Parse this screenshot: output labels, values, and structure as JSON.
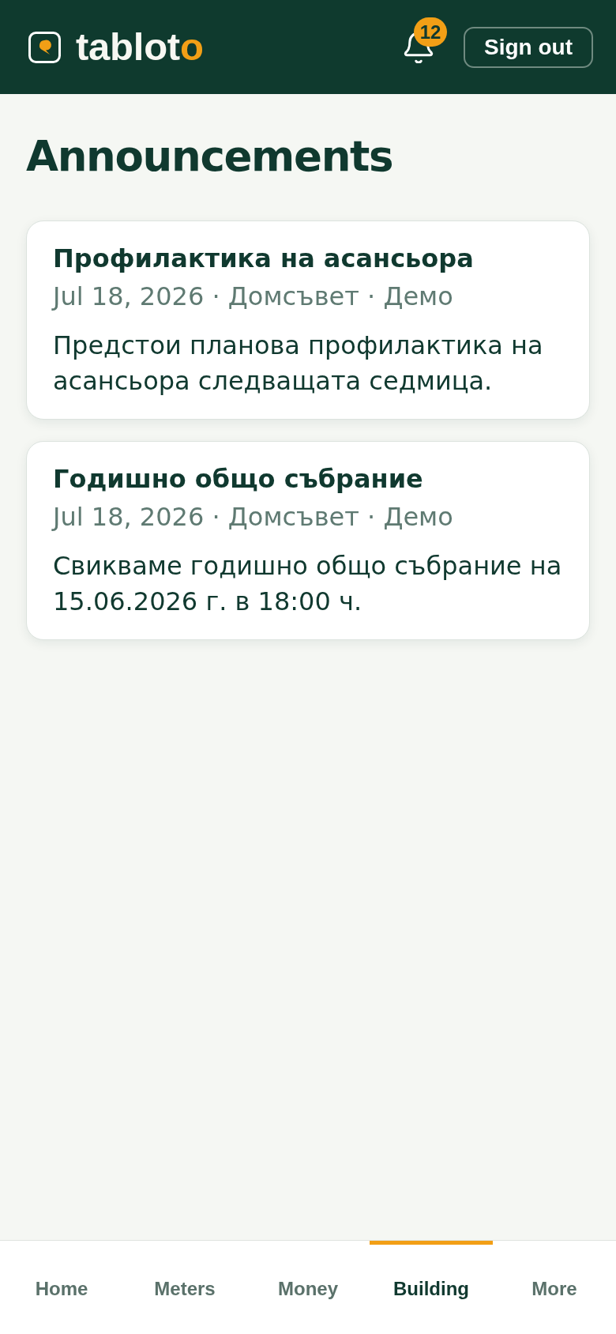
{
  "header": {
    "logo": {
      "text": "tablot",
      "accent": "o"
    },
    "notifications": {
      "count": "12"
    },
    "sign_out": "Sign out"
  },
  "page_title": "Announcements",
  "announcements": [
    {
      "title": "Профилактика на асансьора",
      "meta": "Jul 18, 2026 · Домсъвет · Демо",
      "body": "Предстои планова профилактика на асансьора следващата седмица."
    },
    {
      "title": "Годишно общо събрание",
      "meta": "Jul 18, 2026 · Домсъвет · Демо",
      "body": "Свикваме годишно общо събрание на 15.06.2026 г. в 18:00 ч."
    }
  ],
  "bottom_nav": [
    {
      "label": "Home",
      "selected": false
    },
    {
      "label": "Meters",
      "selected": false
    },
    {
      "label": "Money",
      "selected": false
    },
    {
      "label": "Building",
      "selected": true
    },
    {
      "label": "More",
      "selected": false
    }
  ]
}
